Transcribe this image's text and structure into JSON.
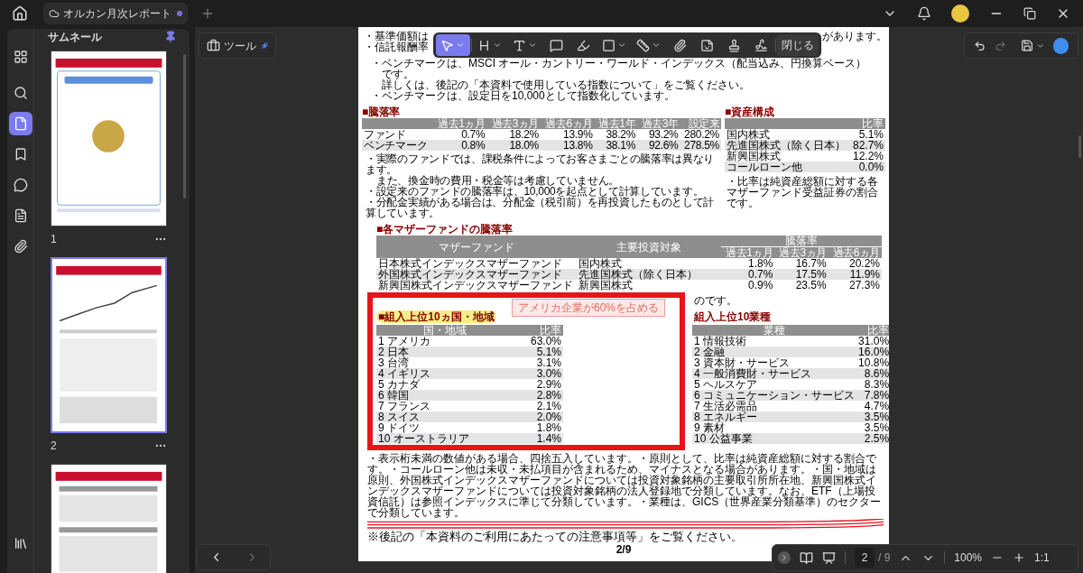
{
  "tab": {
    "title": "オルカン月次レポート",
    "unsaved": true
  },
  "sidebar": {
    "title": "サムネール",
    "pinned": true,
    "nav": [
      {
        "kind": "apps",
        "selected": false
      },
      {
        "kind": "search",
        "selected": false
      },
      {
        "kind": "pages",
        "selected": true
      },
      {
        "kind": "bookmarks",
        "selected": false
      },
      {
        "kind": "comments",
        "selected": false
      },
      {
        "kind": "forms",
        "selected": false
      },
      {
        "kind": "attachments",
        "selected": false
      }
    ],
    "thumbnails": [
      {
        "label": "1",
        "kind": "cover",
        "selected": false
      },
      {
        "label": "2",
        "kind": "chart",
        "selected": true
      },
      {
        "kind": "table",
        "selected": false
      }
    ]
  },
  "tools_button": {
    "label": "ツール"
  },
  "annotation_toolbar": {
    "tools": [
      {
        "kind": "select",
        "selected": true,
        "menu": true
      },
      {
        "kind": "heading",
        "selected": false,
        "menu": true
      },
      {
        "kind": "text",
        "selected": false,
        "menu": true
      },
      {
        "kind": "comment",
        "selected": false,
        "menu": false
      },
      {
        "kind": "highlighter",
        "selected": false,
        "menu": false
      },
      {
        "kind": "shape",
        "selected": false,
        "menu": true
      },
      {
        "kind": "measure",
        "selected": false,
        "menu": true
      },
      {
        "kind": "attach",
        "selected": false,
        "menu": false
      },
      {
        "kind": "sticker",
        "selected": false,
        "menu": false
      },
      {
        "kind": "stamp",
        "selected": false,
        "menu": false
      },
      {
        "kind": "signature",
        "selected": false,
        "menu": false
      }
    ],
    "close": "閉じる"
  },
  "document": {
    "top_notes": [
      {
        "kind": "bullet",
        "text": "・基準価額は"
      },
      {
        "kind": "bullet",
        "text": "・信託報酬率"
      },
      {
        "kind": "bullet",
        "text": "・ベンチマークは、MSCI オール・カントリー・ワールド・インデックス（配当込み、円換算ベース）"
      },
      {
        "kind": "continuation",
        "text": "です。"
      },
      {
        "kind": "continuation",
        "text": "詳しくは、後記の「本資料で使用している指数について」をご覧ください。"
      },
      {
        "kind": "bullet",
        "text": "・ベンチマークは、設定日を10,000として指数化しています。"
      }
    ],
    "top_right_note": "があります。",
    "returns": {
      "title": "■騰落率",
      "columns": [
        "過去1ヵ月",
        "過去3ヵ月",
        "過去6ヵ月",
        "過去1年",
        "過去3年",
        "設定来"
      ],
      "rows": [
        {
          "label": "ファンド",
          "values": [
            "0.7%",
            "18.2%",
            "13.9%",
            "38.2%",
            "93.2%",
            "280.2%"
          ]
        },
        {
          "label": "ベンチマーク",
          "values": [
            "0.8%",
            "18.0%",
            "13.8%",
            "38.1%",
            "92.6%",
            "278.5%"
          ]
        }
      ],
      "notes": [
        {
          "kind": "bullet",
          "text": "・実際のファンドでは、課税条件によってお客さまごとの騰落率は異なります。"
        },
        {
          "kind": "continuation",
          "text": "また、換金時の費用・税金等は考慮していません。"
        },
        {
          "kind": "bullet",
          "text": "・設定来のファンドの騰落率は、10,000を起点として計算しています。"
        },
        {
          "kind": "bullet",
          "text": "・分配金実績がある場合は、分配金（税引前）を再投資したものとして計算しています。"
        }
      ]
    },
    "assets": {
      "title": "■資産構成",
      "column": "比率",
      "rows": [
        {
          "label": "国内株式",
          "value": "5.1%"
        },
        {
          "label": "先進国株式（除く日本）",
          "value": "82.7%"
        },
        {
          "label": "新興国株式",
          "value": "12.2%"
        },
        {
          "label": "コールローン他",
          "value": "0.0%"
        }
      ],
      "note": "・比率は純資産総額に対する各マザーファンド受益証券の割合です。"
    },
    "mother_funds": {
      "title": "■各マザーファンドの騰落率",
      "columns": [
        "マザーファンド",
        "主要投資対象"
      ],
      "group": "騰落率",
      "subcolumns": [
        "過去1ヵ月",
        "過去3ヵ月",
        "過去6ヵ月"
      ],
      "rows": [
        {
          "name": "日本株式インデックスマザーファンド",
          "target": "国内株式",
          "values": [
            "1.8%",
            "16.7%",
            "20.2%"
          ]
        },
        {
          "name": "外国株式インデックスマザーファンド",
          "target": "先進国株式（除く日本）",
          "values": [
            "0.7%",
            "17.5%",
            "11.9%"
          ]
        },
        {
          "name": "新興国株式インデックスマザーファンド",
          "target": "新興国株式",
          "values": [
            "0.9%",
            "23.5%",
            "27.3%"
          ]
        }
      ],
      "note": "のです。"
    },
    "countries": {
      "title": "■組入上位10ヵ国・地域",
      "columns": [
        "国・地域",
        "比率"
      ],
      "rows": [
        {
          "rank": "1",
          "name": "アメリカ",
          "value": "63.0%"
        },
        {
          "rank": "2",
          "name": "日本",
          "value": "5.1%"
        },
        {
          "rank": "3",
          "name": "台湾",
          "value": "3.1%"
        },
        {
          "rank": "4",
          "name": "イギリス",
          "value": "3.0%"
        },
        {
          "rank": "5",
          "name": "カナダ",
          "value": "2.9%"
        },
        {
          "rank": "6",
          "name": "韓国",
          "value": "2.8%"
        },
        {
          "rank": "7",
          "name": "フランス",
          "value": "2.1%"
        },
        {
          "rank": "8",
          "name": "スイス",
          "value": "2.0%"
        },
        {
          "rank": "9",
          "name": "ドイツ",
          "value": "1.8%"
        },
        {
          "rank": "10",
          "name": "オーストラリア",
          "value": "1.4%"
        }
      ]
    },
    "industries": {
      "title": "組入上位10業種",
      "columns": [
        "業種",
        "比率"
      ],
      "rows": [
        {
          "rank": "1",
          "name": "情報技術",
          "value": "31.0%"
        },
        {
          "rank": "2",
          "name": "金融",
          "value": "16.0%"
        },
        {
          "rank": "3",
          "name": "資本財・サービス",
          "value": "10.8%"
        },
        {
          "rank": "4",
          "name": "一般消費財・サービス",
          "value": "8.6%"
        },
        {
          "rank": "5",
          "name": "ヘルスケア",
          "value": "8.3%"
        },
        {
          "rank": "6",
          "name": "コミュニケーション・サービス",
          "value": "7.8%"
        },
        {
          "rank": "7",
          "name": "生活必需品",
          "value": "4.7%"
        },
        {
          "rank": "8",
          "name": "エネルギー",
          "value": "3.5%"
        },
        {
          "rank": "9",
          "name": "素材",
          "value": "3.5%"
        },
        {
          "rank": "10",
          "name": "公益事業",
          "value": "2.5%"
        }
      ]
    },
    "annotations": [
      {
        "kind": "rectangle",
        "color": "#e8141b"
      },
      {
        "kind": "highlight",
        "color": "#f4ee86"
      },
      {
        "kind": "callout",
        "text": "アメリカ企業が60%を占める"
      }
    ],
    "footer_note": "・表示桁未満の数値がある場合、四捨五入しています。・原則として、比率は純資産総額に対する割合です。・コールローン他は未収・未払項目が含まれるため、マイナスとなる場合があります。・国・地域は原則、外国株式インデックスマザーファンドについては投資対象銘柄の主要取引所所在地、新興国株式インデックスマザーファンドについては投資対象銘柄の法人登録地で分類しています。なお、ETF（上場投資信託）は参照インデックスに準じて分類しています。・業種は、GICS（世界産業分類基準）のセクターで分類しています。",
    "closing": "※後記の「本資料のご利用にあたっての注意事項等」をご覧ください。",
    "page_label": "2/9"
  },
  "bottom_bar": {
    "page": "2",
    "total": "/ 9",
    "zoom": "100%",
    "fit": "1:1"
  }
}
